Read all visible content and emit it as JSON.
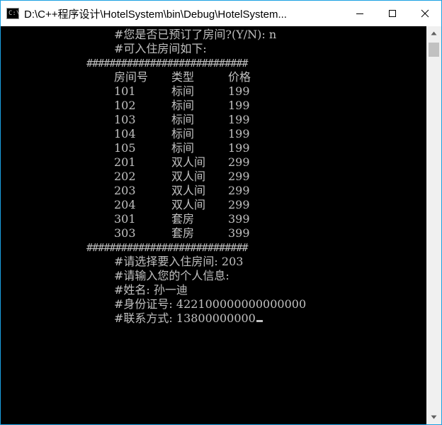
{
  "window": {
    "title": "D:\\C++程序设计\\HotelSystem\\bin\\Debug\\HotelSystem...",
    "app_icon": "C:\\"
  },
  "icons": {
    "app": "console-app-icon",
    "minimize": "minimize-icon",
    "maximize": "maximize-icon",
    "close": "close-icon",
    "scroll_up": "scroll-up-arrow-icon",
    "scroll_down": "scroll-down-arrow-icon"
  },
  "console": {
    "reserve_question": "#您是否已预订了房间?(Y/N): n",
    "available_title": "#可入住房间如下:",
    "separator": "############################",
    "table": {
      "headers": [
        "房间号",
        "类型",
        "价格"
      ],
      "rows": [
        [
          "101",
          "标间",
          "199"
        ],
        [
          "102",
          "标间",
          "199"
        ],
        [
          "103",
          "标间",
          "199"
        ],
        [
          "104",
          "标间",
          "199"
        ],
        [
          "105",
          "标间",
          "199"
        ],
        [
          "201",
          "双人间",
          "299"
        ],
        [
          "202",
          "双人间",
          "299"
        ],
        [
          "203",
          "双人间",
          "299"
        ],
        [
          "204",
          "双人间",
          "299"
        ],
        [
          "301",
          "套房",
          "399"
        ],
        [
          "303",
          "套房",
          "399"
        ]
      ]
    },
    "separator_bottom": "############################",
    "choose_room": "#请选择要入住房间: 203",
    "enter_info": "#请输入您的个人信息:",
    "name": "#姓名: 孙一迪",
    "id_number": "#身份证号: 422100000000000000",
    "contact": "#联系方式: 13800000000"
  },
  "colors": {
    "console_bg": "#000000",
    "console_text": "#c0c0c0",
    "window_border": "#1ba1e2",
    "scrollbar_bg": "#f0f0f0",
    "scrollbar_thumb": "#c1c1c1"
  }
}
